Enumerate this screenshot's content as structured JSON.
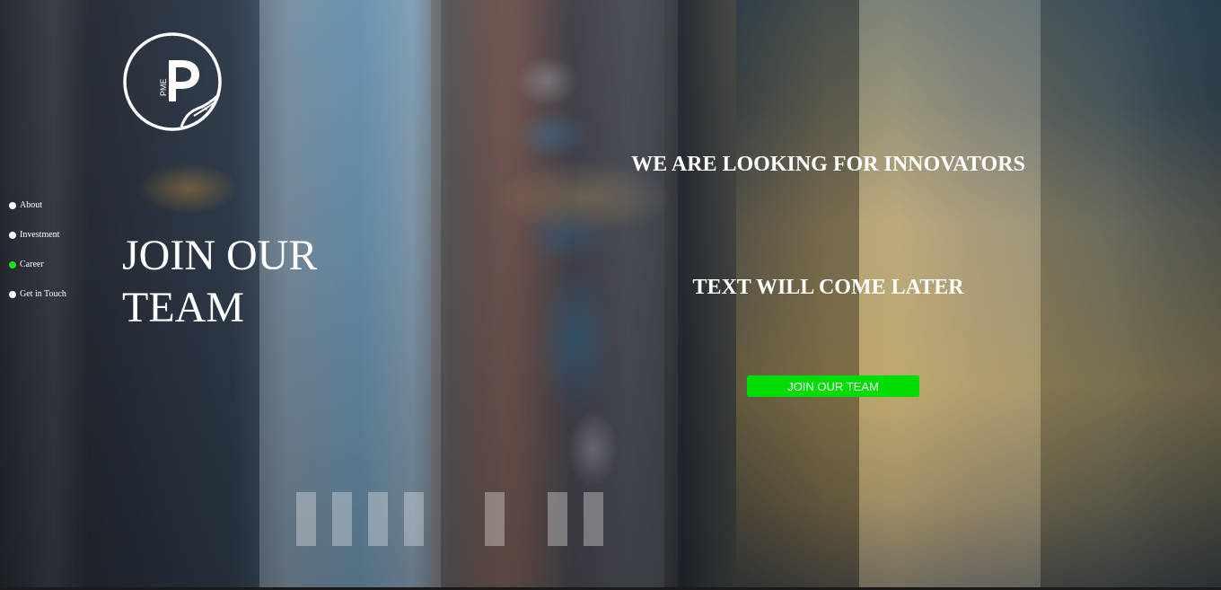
{
  "brand": {
    "logo_letters": "PME",
    "logo_mark": "TM"
  },
  "nav": {
    "items": [
      {
        "label": "About",
        "active": false
      },
      {
        "label": "Investment",
        "active": false
      },
      {
        "label": "Career",
        "active": true
      },
      {
        "label": "Get in Touch",
        "active": false
      }
    ],
    "active_color": "#1ae01a"
  },
  "hero": {
    "headline": "JOIN OUR\nTEAM",
    "tagline": "WE ARE LOOKING FOR INNOVATORS",
    "subtext": "TEXT WILL COME LATER",
    "cta_label": "JOIN OUR TEAM",
    "cta_color": "#00dd00"
  },
  "background": {
    "description_icon": "blurred-city-street-image"
  }
}
